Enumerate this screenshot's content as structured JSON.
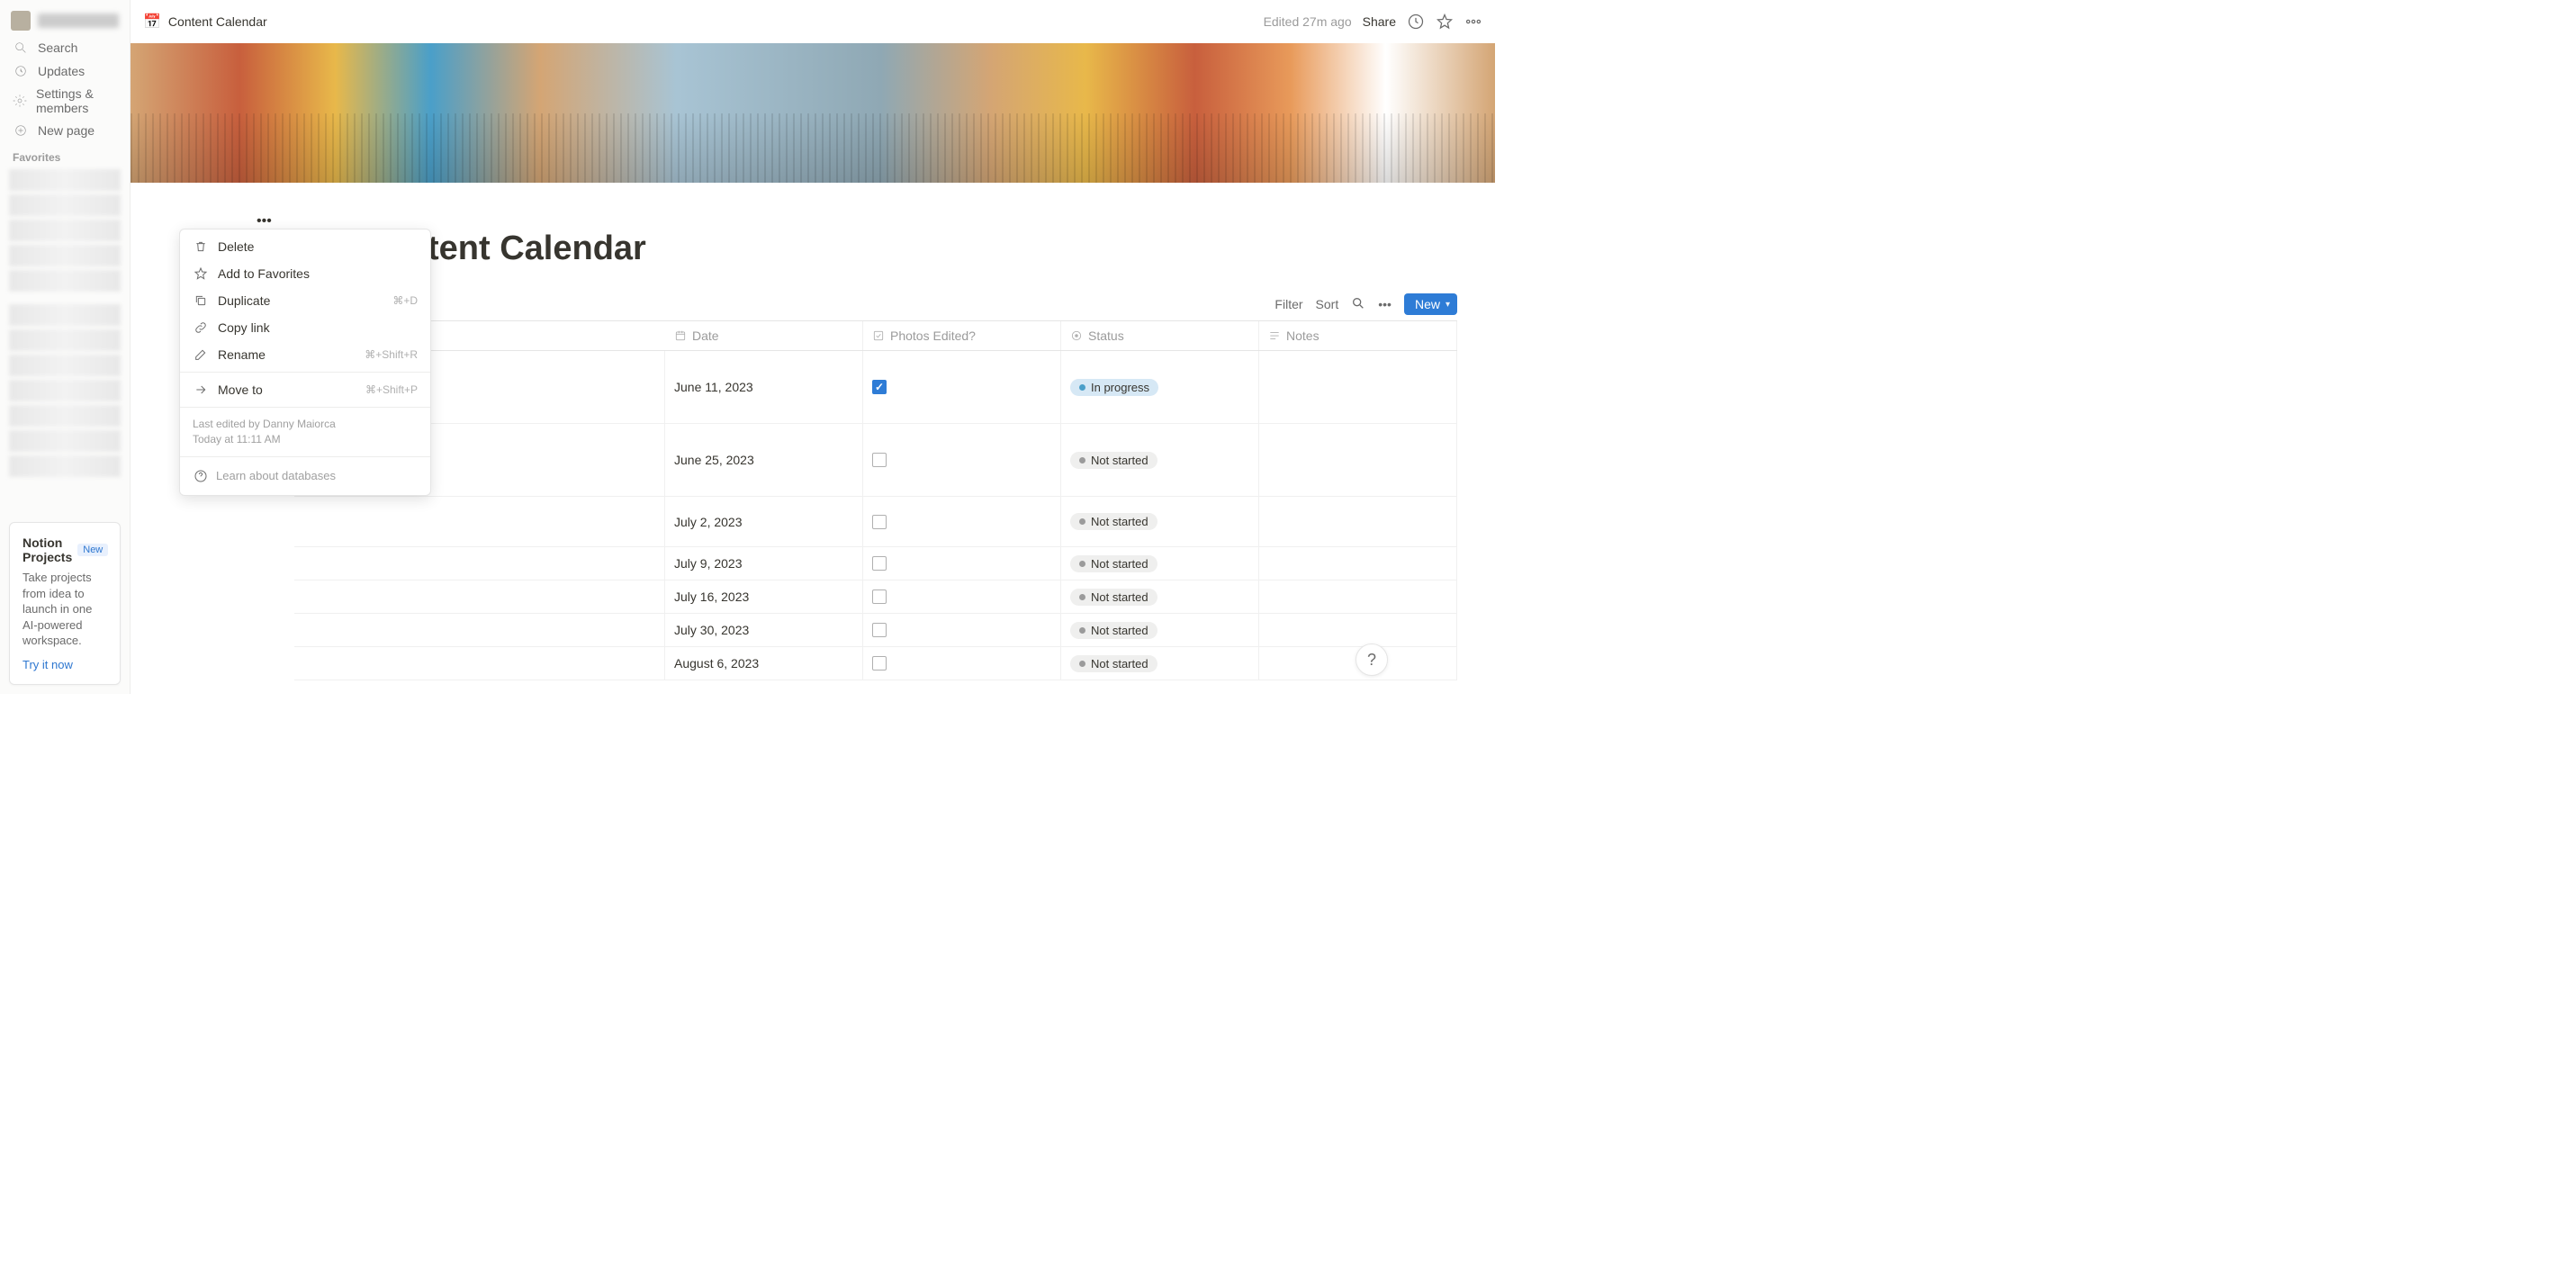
{
  "sidebar": {
    "nav": {
      "search": "Search",
      "updates": "Updates",
      "settings": "Settings & members",
      "newpage": "New page"
    },
    "favorites_header": "Favorites",
    "promo": {
      "title": "Notion Projects",
      "badge": "New",
      "subtitle": "Take projects from idea to launch in one AI-powered workspace.",
      "cta": "Try it now"
    }
  },
  "topbar": {
    "icon": "📅",
    "title": "Content Calendar",
    "edited": "Edited 27m ago",
    "share": "Share"
  },
  "page": {
    "title": "tent Calendar"
  },
  "db_toolbar": {
    "filter": "Filter",
    "sort": "Sort",
    "new": "New"
  },
  "columns": {
    "date": "Date",
    "photos": "Photos Edited?",
    "status": "Status",
    "notes": "Notes"
  },
  "status": {
    "in_progress": "In progress",
    "not_started": "Not started"
  },
  "rows": [
    {
      "date": "June 11, 2023",
      "checked": true,
      "status": "in_progress"
    },
    {
      "date": "June 25, 2023",
      "checked": false,
      "status": "not_started"
    },
    {
      "date": "July 2, 2023",
      "checked": false,
      "status": "not_started"
    },
    {
      "date": "July 9, 2023",
      "checked": false,
      "status": "not_started"
    },
    {
      "date": "July 16, 2023",
      "checked": false,
      "status": "not_started"
    },
    {
      "date": "July 30, 2023",
      "checked": false,
      "status": "not_started"
    },
    {
      "date": "August 6, 2023",
      "checked": false,
      "status": "not_started"
    }
  ],
  "context_menu": {
    "delete": "Delete",
    "favorites": "Add to Favorites",
    "duplicate": "Duplicate",
    "duplicate_sc": "⌘+D",
    "copylink": "Copy link",
    "rename": "Rename",
    "rename_sc": "⌘+Shift+R",
    "moveto": "Move to",
    "moveto_sc": "⌘+Shift+P",
    "last_edited_by": "Last edited by Danny Maiorca",
    "last_edited_at": "Today at 11:11 AM",
    "learn": "Learn about databases"
  },
  "help": "?"
}
